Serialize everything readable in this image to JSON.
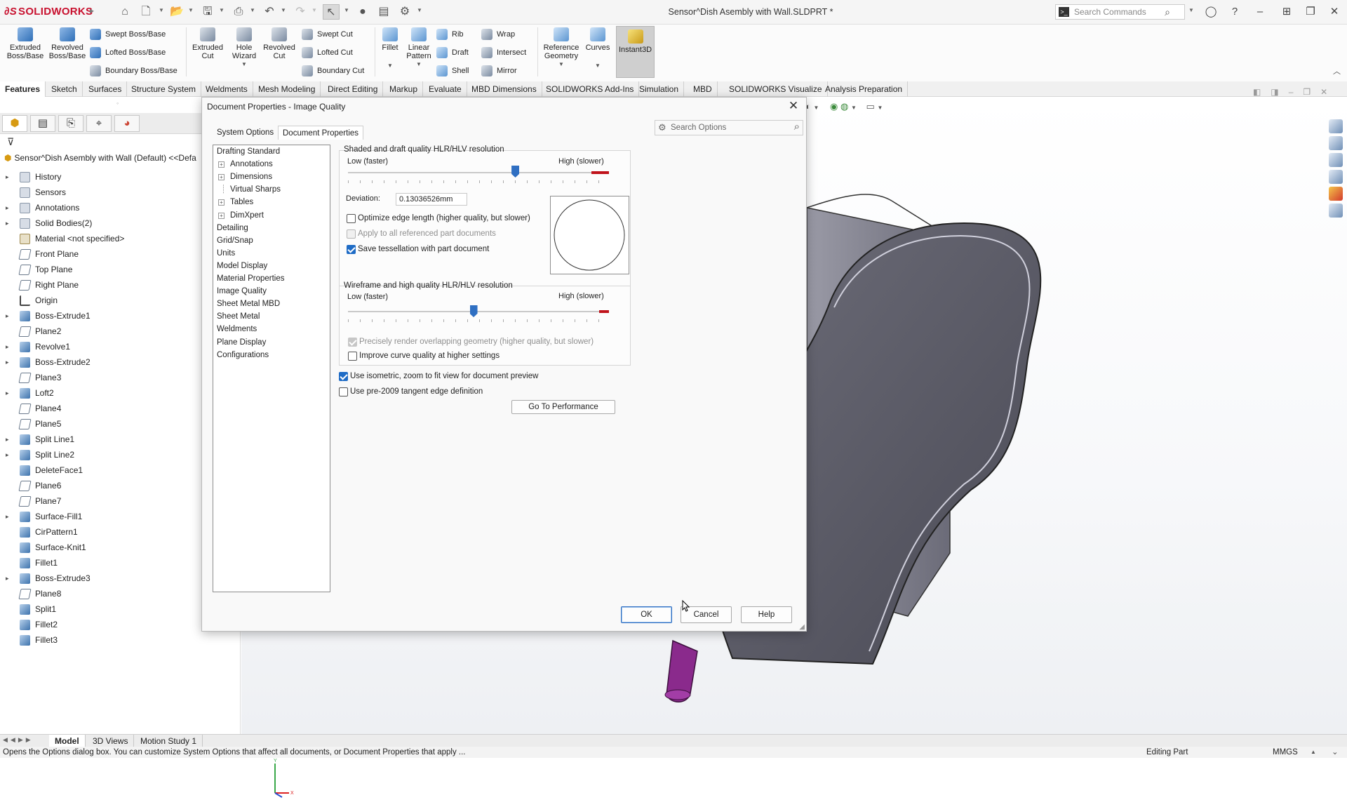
{
  "app": {
    "brand": "SOLIDWORKS",
    "window_title": "Sensor^Dish Asembly with Wall.SLDPRT *",
    "search_commands_placeholder": "Search Commands"
  },
  "ribbon": {
    "extruded_boss": "Extruded Boss/Base",
    "revolved_boss": "Revolved Boss/Base",
    "swept_boss": "Swept Boss/Base",
    "lofted_boss": "Lofted Boss/Base",
    "boundary_boss": "Boundary Boss/Base",
    "extruded_cut": "Extruded Cut",
    "hole_wizard": "Hole Wizard",
    "revolved_cut": "Revolved Cut",
    "swept_cut": "Swept Cut",
    "lofted_cut": "Lofted Cut",
    "boundary_cut": "Boundary Cut",
    "fillet": "Fillet",
    "linear_pattern": "Linear Pattern",
    "rib": "Rib",
    "draft": "Draft",
    "shell": "Shell",
    "wrap": "Wrap",
    "intersect": "Intersect",
    "mirror": "Mirror",
    "reference_geometry": "Reference Geometry",
    "curves": "Curves",
    "instant3d": "Instant3D"
  },
  "tabs": [
    "Features",
    "Sketch",
    "Surfaces",
    "Structure System",
    "Weldments",
    "Mesh Modeling",
    "Direct Editing",
    "Markup",
    "Evaluate",
    "MBD Dimensions",
    "SOLIDWORKS Add-Ins",
    "Simulation",
    "MBD",
    "SOLIDWORKS Visualize",
    "Analysis Preparation"
  ],
  "feature_tree": {
    "root": "Sensor^Dish Asembly with Wall (Default) <<Defa",
    "items": [
      {
        "label": "History",
        "icon": "folder",
        "expandable": true
      },
      {
        "label": "Sensors",
        "icon": "folder",
        "expandable": false
      },
      {
        "label": "Annotations",
        "icon": "folder",
        "expandable": true
      },
      {
        "label": "Solid Bodies(2)",
        "icon": "folder",
        "expandable": true
      },
      {
        "label": "Material <not specified>",
        "icon": "material",
        "expandable": false
      },
      {
        "label": "Front Plane",
        "icon": "plane",
        "expandable": false
      },
      {
        "label": "Top Plane",
        "icon": "plane",
        "expandable": false
      },
      {
        "label": "Right Plane",
        "icon": "plane",
        "expandable": false
      },
      {
        "label": "Origin",
        "icon": "origin",
        "expandable": false
      },
      {
        "label": "Boss-Extrude1",
        "icon": "feature",
        "expandable": true
      },
      {
        "label": "Plane2",
        "icon": "plane",
        "expandable": false
      },
      {
        "label": "Revolve1",
        "icon": "feature",
        "expandable": true
      },
      {
        "label": "Boss-Extrude2",
        "icon": "feature",
        "expandable": true
      },
      {
        "label": "Plane3",
        "icon": "plane",
        "expandable": false
      },
      {
        "label": "Loft2",
        "icon": "feature",
        "expandable": true
      },
      {
        "label": "Plane4",
        "icon": "plane",
        "expandable": false
      },
      {
        "label": "Plane5",
        "icon": "plane",
        "expandable": false
      },
      {
        "label": "Split Line1",
        "icon": "feature",
        "expandable": true
      },
      {
        "label": "Split Line2",
        "icon": "feature",
        "expandable": true
      },
      {
        "label": "DeleteFace1",
        "icon": "feature",
        "expandable": false
      },
      {
        "label": "Plane6",
        "icon": "plane",
        "expandable": false
      },
      {
        "label": "Plane7",
        "icon": "plane",
        "expandable": false
      },
      {
        "label": "Surface-Fill1",
        "icon": "feature",
        "expandable": true
      },
      {
        "label": "CirPattern1",
        "icon": "feature",
        "expandable": false
      },
      {
        "label": "Surface-Knit1",
        "icon": "feature",
        "expandable": false
      },
      {
        "label": "Fillet1",
        "icon": "feature",
        "expandable": false
      },
      {
        "label": "Boss-Extrude3",
        "icon": "feature",
        "expandable": true
      },
      {
        "label": "Plane8",
        "icon": "plane",
        "expandable": false
      },
      {
        "label": "Split1",
        "icon": "feature",
        "expandable": false
      },
      {
        "label": "Fillet2",
        "icon": "feature",
        "expandable": false
      },
      {
        "label": "Fillet3",
        "icon": "feature",
        "expandable": false
      }
    ]
  },
  "dialog": {
    "title": "Document Properties - Image Quality",
    "tab_system": "System Options",
    "tab_document": "Document Properties",
    "search_placeholder": "Search Options",
    "nav": [
      {
        "label": "Drafting Standard",
        "sub": false,
        "plus": false
      },
      {
        "label": "Annotations",
        "sub": true,
        "plus": true
      },
      {
        "label": "Dimensions",
        "sub": true,
        "plus": true
      },
      {
        "label": "Virtual Sharps",
        "sub": true,
        "plus": false
      },
      {
        "label": "Tables",
        "sub": true,
        "plus": true
      },
      {
        "label": "DimXpert",
        "sub": true,
        "plus": true
      },
      {
        "label": "Detailing",
        "sub": false,
        "plus": false
      },
      {
        "label": "Grid/Snap",
        "sub": false,
        "plus": false
      },
      {
        "label": "Units",
        "sub": false,
        "plus": false
      },
      {
        "label": "Model Display",
        "sub": false,
        "plus": false
      },
      {
        "label": "Material Properties",
        "sub": false,
        "plus": false
      },
      {
        "label": "Image Quality",
        "sub": false,
        "plus": false
      },
      {
        "label": "Sheet Metal MBD",
        "sub": false,
        "plus": false
      },
      {
        "label": "Sheet Metal",
        "sub": false,
        "plus": false
      },
      {
        "label": "Weldments",
        "sub": false,
        "plus": false
      },
      {
        "label": "Plane Display",
        "sub": false,
        "plus": false
      },
      {
        "label": "Configurations",
        "sub": false,
        "plus": false
      }
    ],
    "shaded": {
      "title": "Shaded and draft quality HLR/HLV resolution",
      "low": "Low (faster)",
      "high": "High (slower)",
      "slider_fraction": 0.64,
      "deviation_label": "Deviation:",
      "deviation_value": "0.13036526mm",
      "optimize_edge": "Optimize edge length (higher quality, but slower)",
      "apply_all": "Apply to all referenced part documents",
      "save_tess": "Save tessellation with part document"
    },
    "wireframe": {
      "title": "Wireframe and high quality HLR/HLV resolution",
      "low": "Low (faster)",
      "high": "High (slower)",
      "slider_fraction": 0.48,
      "precise": "Precisely render overlapping geometry (higher quality, but slower)",
      "improve_curve": "Improve curve quality at higher settings"
    },
    "use_isometric": "Use isometric, zoom to fit view for document preview",
    "pre2009": "Use pre-2009 tangent edge definition",
    "go_perf": "Go To Performance",
    "ok": "OK",
    "cancel": "Cancel",
    "help": "Help"
  },
  "bottom_tabs": [
    "Model",
    "3D Views",
    "Motion Study 1"
  ],
  "status": {
    "message": "Opens the Options dialog box. You can customize System Options that affect all documents, or Document Properties that apply ...",
    "mode": "Editing Part",
    "units": "MMGS"
  },
  "colors": {
    "accent": "#2f6fc2",
    "brand": "#c8102e",
    "part_body": "#5a5a66",
    "part_connector": "#8a2a8c"
  }
}
